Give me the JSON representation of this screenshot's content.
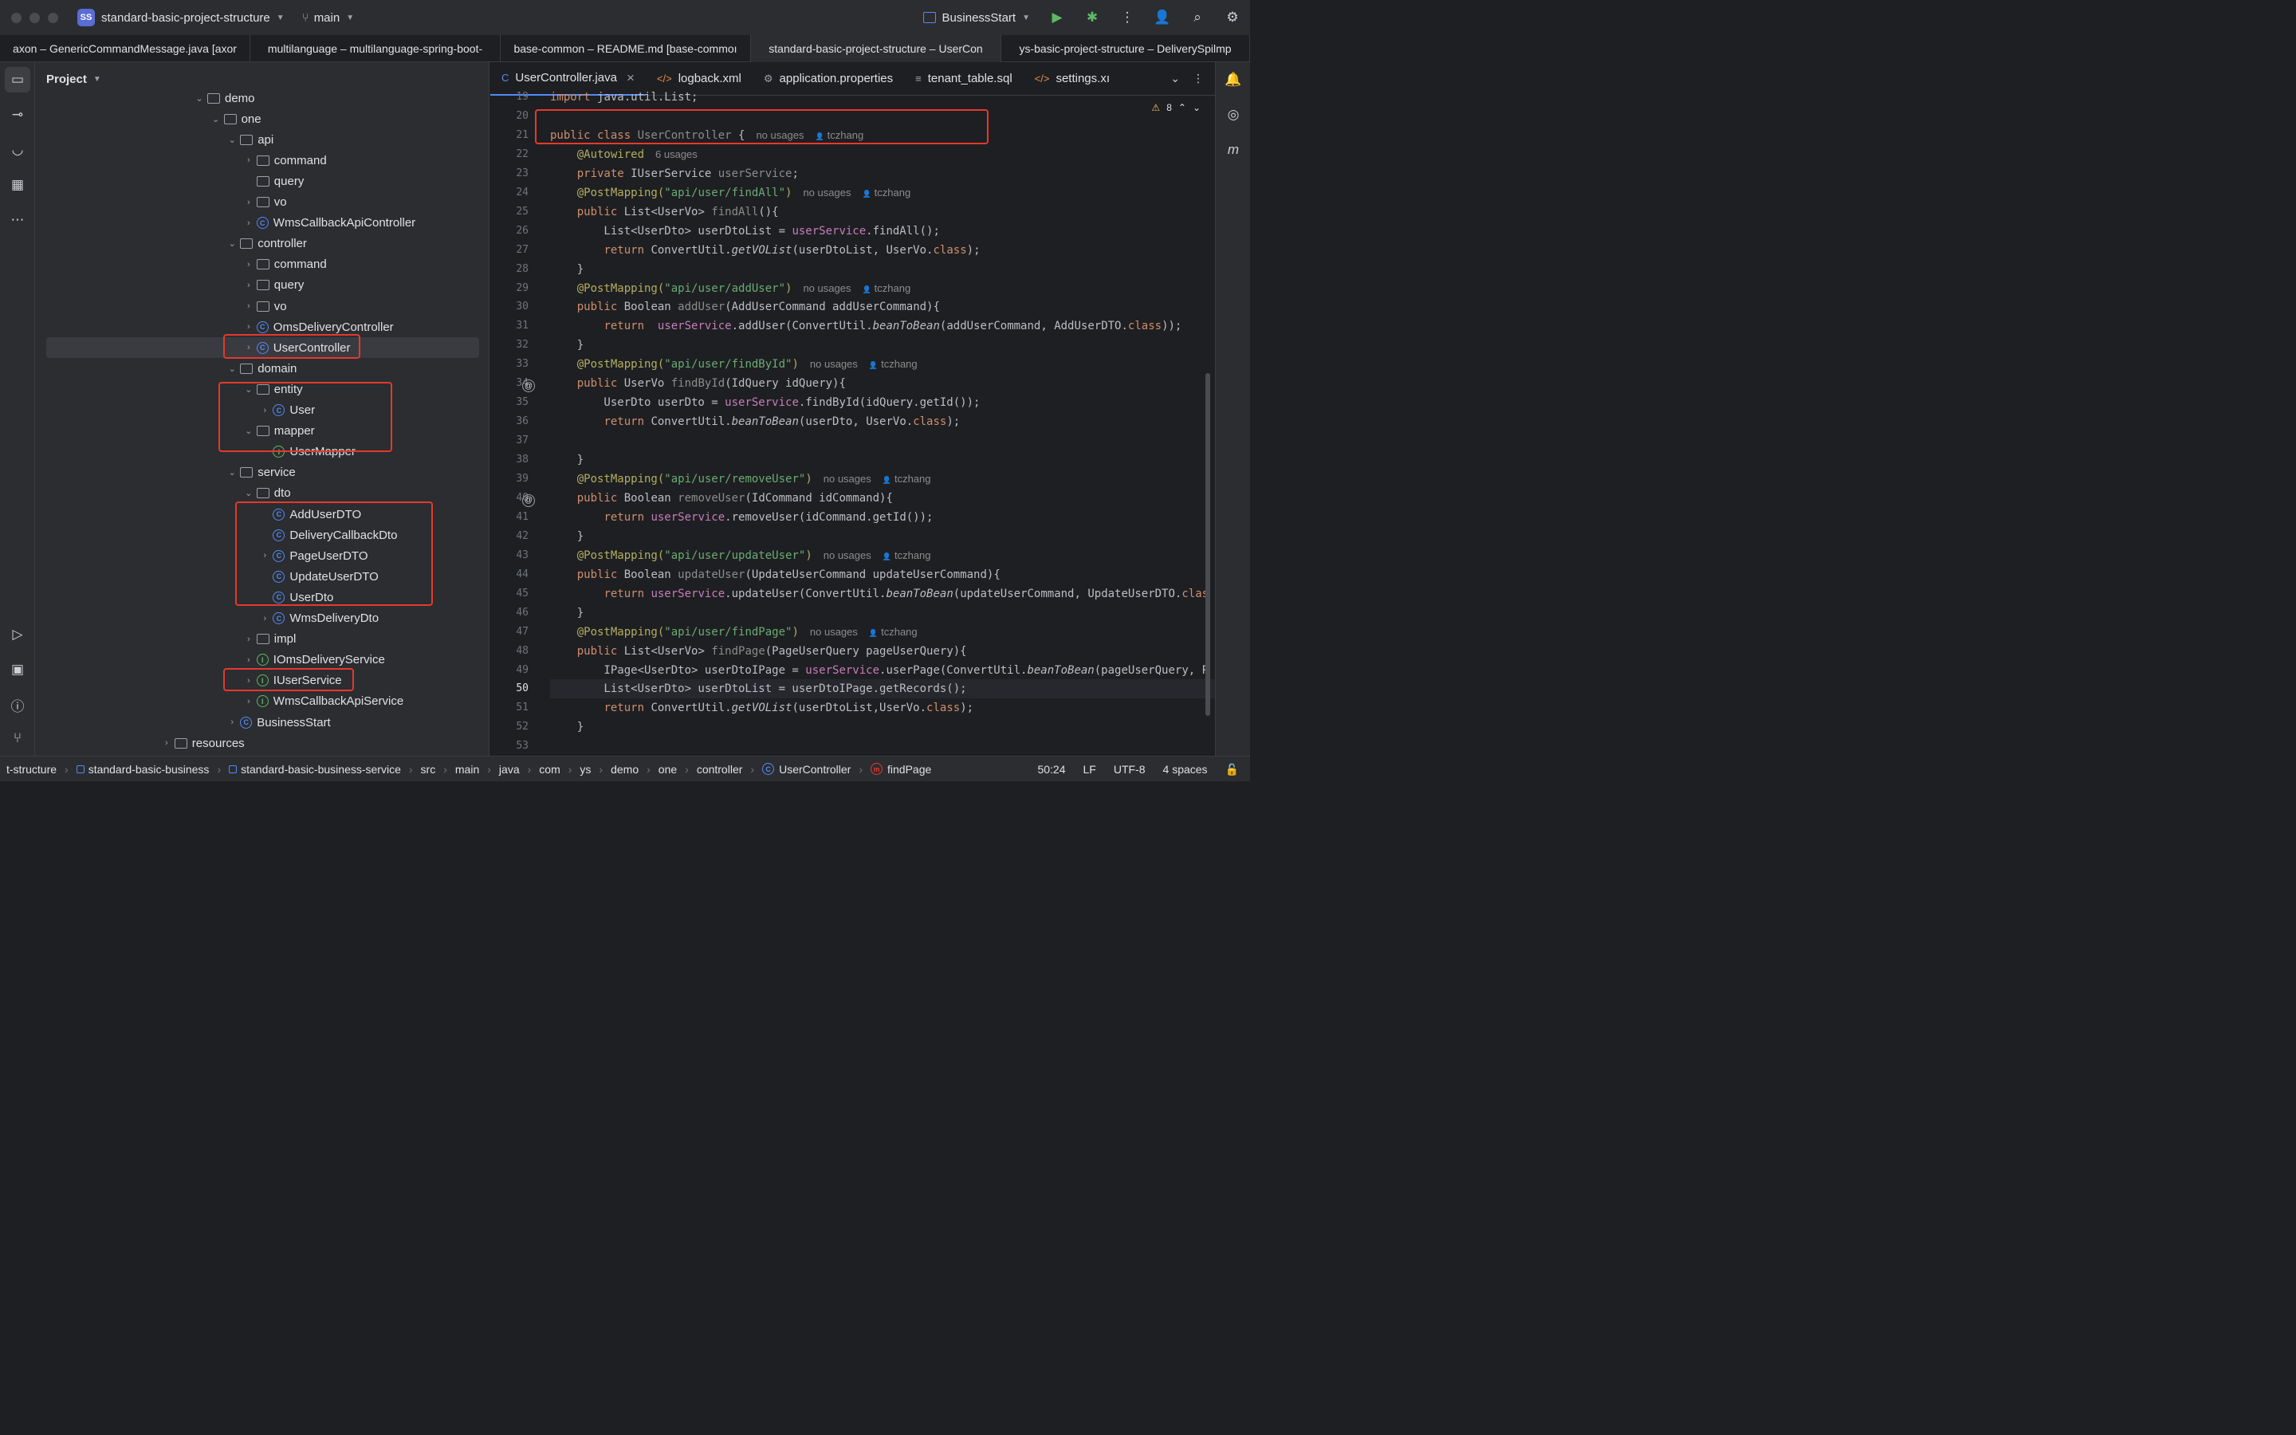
{
  "titlebar": {
    "badge": "SS",
    "project": "standard-basic-project-structure",
    "branch": "main",
    "run_config": "BusinessStart"
  },
  "window_tabs": [
    "axon – GenericCommandMessage.java [axor",
    "multilanguage – multilanguage-spring-boot-",
    "base-common – README.md [base-commoı",
    "standard-basic-project-structure – UserCon",
    "ys-basic-project-structure – DeliverySpilmp"
  ],
  "project_panel": {
    "title": "Project",
    "tree": [
      {
        "label": "demo",
        "indent": 10,
        "arrow": "v",
        "icon": "folder"
      },
      {
        "label": "one",
        "indent": 11,
        "arrow": "v",
        "icon": "folder"
      },
      {
        "label": "api",
        "indent": 12,
        "arrow": "v",
        "icon": "folder"
      },
      {
        "label": "command",
        "indent": 13,
        "arrow": ">",
        "icon": "folder"
      },
      {
        "label": "query",
        "indent": 13,
        "arrow": "",
        "icon": "folder"
      },
      {
        "label": "vo",
        "indent": 13,
        "arrow": ">",
        "icon": "folder"
      },
      {
        "label": "WmsCallbackApiController",
        "indent": 13,
        "arrow": ">",
        "icon": "class"
      },
      {
        "label": "controller",
        "indent": 12,
        "arrow": "v",
        "icon": "folder"
      },
      {
        "label": "command",
        "indent": 13,
        "arrow": ">",
        "icon": "folder"
      },
      {
        "label": "query",
        "indent": 13,
        "arrow": ">",
        "icon": "folder"
      },
      {
        "label": "vo",
        "indent": 13,
        "arrow": ">",
        "icon": "folder"
      },
      {
        "label": "OmsDeliveryController",
        "indent": 13,
        "arrow": ">",
        "icon": "class"
      },
      {
        "label": "UserController",
        "indent": 13,
        "arrow": ">",
        "icon": "class",
        "selected": true
      },
      {
        "label": "domain",
        "indent": 12,
        "arrow": "v",
        "icon": "folder"
      },
      {
        "label": "entity",
        "indent": 13,
        "arrow": "v",
        "icon": "folder"
      },
      {
        "label": "User",
        "indent": 14,
        "arrow": ">",
        "icon": "class"
      },
      {
        "label": "mapper",
        "indent": 13,
        "arrow": "v",
        "icon": "folder"
      },
      {
        "label": "UserMapper",
        "indent": 14,
        "arrow": "",
        "icon": "interface"
      },
      {
        "label": "service",
        "indent": 12,
        "arrow": "v",
        "icon": "folder"
      },
      {
        "label": "dto",
        "indent": 13,
        "arrow": "v",
        "icon": "folder"
      },
      {
        "label": "AddUserDTO",
        "indent": 14,
        "arrow": "",
        "icon": "class"
      },
      {
        "label": "DeliveryCallbackDto",
        "indent": 14,
        "arrow": "",
        "icon": "class"
      },
      {
        "label": "PageUserDTO",
        "indent": 14,
        "arrow": ">",
        "icon": "class"
      },
      {
        "label": "UpdateUserDTO",
        "indent": 14,
        "arrow": "",
        "icon": "class"
      },
      {
        "label": "UserDto",
        "indent": 14,
        "arrow": "",
        "icon": "class"
      },
      {
        "label": "WmsDeliveryDto",
        "indent": 14,
        "arrow": ">",
        "icon": "class"
      },
      {
        "label": "impl",
        "indent": 13,
        "arrow": ">",
        "icon": "folder"
      },
      {
        "label": "IOmsDeliveryService",
        "indent": 13,
        "arrow": ">",
        "icon": "interface"
      },
      {
        "label": "IUserService",
        "indent": 13,
        "arrow": ">",
        "icon": "interface"
      },
      {
        "label": "WmsCallbackApiService",
        "indent": 13,
        "arrow": ">",
        "icon": "interface"
      },
      {
        "label": "BusinessStart",
        "indent": 12,
        "arrow": ">",
        "icon": "class"
      },
      {
        "label": "resources",
        "indent": 8,
        "arrow": ">",
        "icon": "folder"
      }
    ]
  },
  "editor": {
    "tabs": [
      {
        "label": "UserController.java",
        "icon": "C",
        "active": true,
        "closable": true
      },
      {
        "label": "logback.xml",
        "icon": "</>"
      },
      {
        "label": "application.properties",
        "icon": "⚙"
      },
      {
        "label": "tenant_table.sql",
        "icon": "≡"
      },
      {
        "label": "settings.xı",
        "icon": "</>"
      }
    ],
    "warnings": "8",
    "current_line": 50,
    "lines": [
      {
        "n": 19,
        "tokens": [
          [
            "kw",
            "import "
          ],
          [
            "cls",
            "java.util.List;"
          ]
        ]
      },
      {
        "n": 20,
        "tokens": []
      },
      {
        "n": 21,
        "tokens": [
          [
            "kw",
            "public class "
          ],
          [
            "unused",
            "UserController "
          ],
          [
            "cls",
            "{"
          ]
        ],
        "hint": "no usages",
        "author": "tczhang"
      },
      {
        "n": 22,
        "tokens": [
          [
            "cls",
            "    "
          ],
          [
            "ann",
            "@Autowired"
          ]
        ],
        "hint": "6 usages"
      },
      {
        "n": 23,
        "tokens": [
          [
            "cls",
            "    "
          ],
          [
            "kw",
            "private "
          ],
          [
            "cls",
            "IUserService "
          ],
          [
            "unused",
            "userService"
          ],
          [
            "cls",
            ";"
          ]
        ]
      },
      {
        "n": 24,
        "tokens": [
          [
            "cls",
            "    "
          ],
          [
            "ann",
            "@PostMapping("
          ],
          [
            "str",
            "\"api/user/findAll\""
          ],
          [
            "ann",
            ")"
          ]
        ],
        "hint": "no usages",
        "author": "tczhang"
      },
      {
        "n": 25,
        "tokens": [
          [
            "cls",
            "    "
          ],
          [
            "kw",
            "public "
          ],
          [
            "cls",
            "List<UserVo> "
          ],
          [
            "unused",
            "findAll"
          ],
          [
            "cls",
            "(){"
          ]
        ]
      },
      {
        "n": 26,
        "tokens": [
          [
            "cls",
            "        List<UserDto> userDtoList = "
          ],
          [
            "fld",
            "userService"
          ],
          [
            "cls",
            ".findAll();"
          ]
        ]
      },
      {
        "n": 27,
        "tokens": [
          [
            "cls",
            "        "
          ],
          [
            "kw",
            "return "
          ],
          [
            "cls",
            "ConvertUtil."
          ],
          [
            "ital",
            "getVOList"
          ],
          [
            "cls",
            "(userDtoList, UserVo."
          ],
          [
            "kw",
            "class"
          ],
          [
            "cls",
            ");"
          ]
        ]
      },
      {
        "n": 28,
        "tokens": [
          [
            "cls",
            "    }"
          ]
        ]
      },
      {
        "n": 29,
        "tokens": [
          [
            "cls",
            "    "
          ],
          [
            "ann",
            "@PostMapping("
          ],
          [
            "str",
            "\"api/user/addUser\""
          ],
          [
            "ann",
            ")"
          ]
        ],
        "hint": "no usages",
        "author": "tczhang"
      },
      {
        "n": 30,
        "tokens": [
          [
            "cls",
            "    "
          ],
          [
            "kw",
            "public "
          ],
          [
            "cls",
            "Boolean "
          ],
          [
            "unused",
            "addUser"
          ],
          [
            "cls",
            "(AddUserCommand addUserCommand){"
          ]
        ]
      },
      {
        "n": 31,
        "tokens": [
          [
            "cls",
            "        "
          ],
          [
            "kw",
            "return  "
          ],
          [
            "fld",
            "userService"
          ],
          [
            "cls",
            ".addUser(ConvertUtil."
          ],
          [
            "ital",
            "beanToBean"
          ],
          [
            "cls",
            "(addUserCommand, AddUserDTO."
          ],
          [
            "kw",
            "class"
          ],
          [
            "cls",
            "));"
          ]
        ]
      },
      {
        "n": 32,
        "tokens": [
          [
            "cls",
            "    }"
          ]
        ]
      },
      {
        "n": 33,
        "tokens": [
          [
            "cls",
            "    "
          ],
          [
            "ann",
            "@PostMapping("
          ],
          [
            "str",
            "\"api/user/findById\""
          ],
          [
            "ann",
            ")"
          ]
        ],
        "hint": "no usages",
        "author": "tczhang"
      },
      {
        "n": 34,
        "tokens": [
          [
            "cls",
            "    "
          ],
          [
            "kw",
            "public "
          ],
          [
            "cls",
            "UserVo "
          ],
          [
            "unused",
            "findById"
          ],
          [
            "cls",
            "(IdQuery idQuery){"
          ]
        ],
        "gutter_icon": "@"
      },
      {
        "n": 35,
        "tokens": [
          [
            "cls",
            "        UserDto userDto = "
          ],
          [
            "fld",
            "userService"
          ],
          [
            "cls",
            ".findById(idQuery.getId());"
          ]
        ]
      },
      {
        "n": 36,
        "tokens": [
          [
            "cls",
            "        "
          ],
          [
            "kw",
            "return "
          ],
          [
            "cls",
            "ConvertUtil."
          ],
          [
            "ital",
            "beanToBean"
          ],
          [
            "cls",
            "(userDto, UserVo."
          ],
          [
            "kw",
            "class"
          ],
          [
            "cls",
            ");"
          ]
        ]
      },
      {
        "n": 37,
        "tokens": []
      },
      {
        "n": 38,
        "tokens": [
          [
            "cls",
            "    }"
          ]
        ]
      },
      {
        "n": 39,
        "tokens": [
          [
            "cls",
            "    "
          ],
          [
            "ann",
            "@PostMapping("
          ],
          [
            "str",
            "\"api/user/removeUser\""
          ],
          [
            "ann",
            ")"
          ]
        ],
        "hint": "no usages",
        "author": "tczhang"
      },
      {
        "n": 40,
        "tokens": [
          [
            "cls",
            "    "
          ],
          [
            "kw",
            "public "
          ],
          [
            "cls",
            "Boolean "
          ],
          [
            "unused",
            "removeUser"
          ],
          [
            "cls",
            "(IdCommand idCommand){"
          ]
        ],
        "gutter_icon": "@"
      },
      {
        "n": 41,
        "tokens": [
          [
            "cls",
            "        "
          ],
          [
            "kw",
            "return "
          ],
          [
            "fld",
            "userService"
          ],
          [
            "cls",
            ".removeUser(idCommand.getId());"
          ]
        ]
      },
      {
        "n": 42,
        "tokens": [
          [
            "cls",
            "    }"
          ]
        ]
      },
      {
        "n": 43,
        "tokens": [
          [
            "cls",
            "    "
          ],
          [
            "ann",
            "@PostMapping("
          ],
          [
            "str",
            "\"api/user/updateUser\""
          ],
          [
            "ann",
            ")"
          ]
        ],
        "hint": "no usages",
        "author": "tczhang"
      },
      {
        "n": 44,
        "tokens": [
          [
            "cls",
            "    "
          ],
          [
            "kw",
            "public "
          ],
          [
            "cls",
            "Boolean "
          ],
          [
            "unused",
            "updateUser"
          ],
          [
            "cls",
            "(UpdateUserCommand updateUserCommand){"
          ]
        ]
      },
      {
        "n": 45,
        "tokens": [
          [
            "cls",
            "        "
          ],
          [
            "kw",
            "return "
          ],
          [
            "fld",
            "userService"
          ],
          [
            "cls",
            ".updateUser(ConvertUtil."
          ],
          [
            "ital",
            "beanToBean"
          ],
          [
            "cls",
            "(updateUserCommand, UpdateUserDTO."
          ],
          [
            "kw",
            "clas"
          ]
        ]
      },
      {
        "n": 46,
        "tokens": [
          [
            "cls",
            "    }"
          ]
        ]
      },
      {
        "n": 47,
        "tokens": [
          [
            "cls",
            "    "
          ],
          [
            "ann",
            "@PostMapping("
          ],
          [
            "str",
            "\"api/user/findPage\""
          ],
          [
            "ann",
            ")"
          ]
        ],
        "hint": "no usages",
        "author": "tczhang"
      },
      {
        "n": 48,
        "tokens": [
          [
            "cls",
            "    "
          ],
          [
            "kw",
            "public "
          ],
          [
            "cls",
            "List<UserVo> "
          ],
          [
            "unused",
            "findPage"
          ],
          [
            "cls",
            "(PageUserQuery pageUserQuery){"
          ]
        ]
      },
      {
        "n": 49,
        "tokens": [
          [
            "cls",
            "        IPage<UserDto> userDtoIPage = "
          ],
          [
            "fld",
            "userService"
          ],
          [
            "cls",
            ".userPage(ConvertUtil."
          ],
          [
            "ital",
            "beanToBean"
          ],
          [
            "cls",
            "(pageUserQuery, P"
          ]
        ]
      },
      {
        "n": 50,
        "tokens": [
          [
            "cls",
            "        List<UserDto> userDtoList = userDtoIPage.getRecords();"
          ]
        ]
      },
      {
        "n": 51,
        "tokens": [
          [
            "cls",
            "        "
          ],
          [
            "kw",
            "return "
          ],
          [
            "cls",
            "ConvertUtil."
          ],
          [
            "ital",
            "getVOList"
          ],
          [
            "cls",
            "(userDtoList,UserVo."
          ],
          [
            "kw",
            "class"
          ],
          [
            "cls",
            ");"
          ]
        ]
      },
      {
        "n": 52,
        "tokens": [
          [
            "cls",
            "    }"
          ]
        ]
      },
      {
        "n": 53,
        "tokens": []
      }
    ]
  },
  "statusbar": {
    "crumbs": [
      "t-structure",
      "standard-basic-business",
      "standard-basic-business-service",
      "src",
      "main",
      "java",
      "com",
      "ys",
      "demo",
      "one",
      "controller",
      "UserController",
      "findPage"
    ],
    "position": "50:24",
    "line_sep": "LF",
    "encoding": "UTF-8",
    "indent": "4 spaces"
  },
  "colors": {
    "accent": "#548af7",
    "highlight_box": "#e5392d"
  }
}
